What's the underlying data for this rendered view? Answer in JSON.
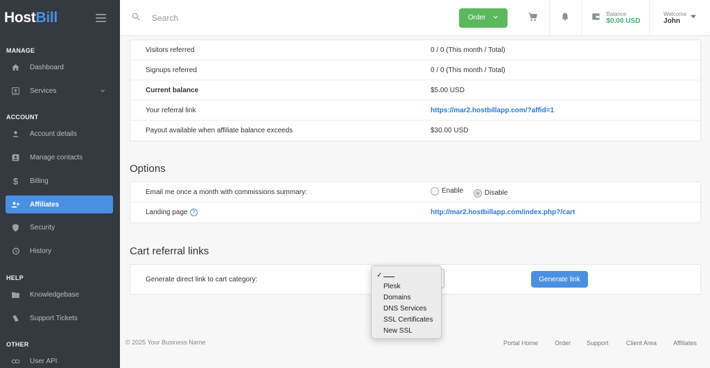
{
  "app": {
    "logo_host": "Host",
    "logo_bill": "Bill"
  },
  "sidebar": {
    "sections": {
      "manage": "MANAGE",
      "account": "ACCOUNT",
      "help": "HELP",
      "other": "OTHER"
    },
    "items": [
      {
        "label": "Dashboard",
        "icon": "home-icon"
      },
      {
        "label": "Services",
        "icon": "services-icon"
      },
      {
        "label": "Account details",
        "icon": "user-icon"
      },
      {
        "label": "Manage contacts",
        "icon": "contacts-icon"
      },
      {
        "label": "Billing",
        "icon": "dollar-icon"
      },
      {
        "label": "Affiliates",
        "icon": "add-user-icon"
      },
      {
        "label": "Security",
        "icon": "shield-icon"
      },
      {
        "label": "History",
        "icon": "history-icon"
      },
      {
        "label": "Knowledgebase",
        "icon": "folder-icon"
      },
      {
        "label": "Support Tickets",
        "icon": "tickets-icon"
      },
      {
        "label": "User API",
        "icon": "link-icon"
      }
    ]
  },
  "topbar": {
    "search_placeholder": "Search",
    "order_label": "Order",
    "balance_label": "Balance",
    "balance_value": "$0.00 USD",
    "welcome_label": "Welcome",
    "welcome_name": "John"
  },
  "stats": {
    "rows": [
      {
        "key": "Visitors referred",
        "value": "0 / 0 (This month / Total)"
      },
      {
        "key": "Signups referred",
        "value": "0 / 0 (This month / Total)"
      },
      {
        "key": "Current balance",
        "value": "$5.00 USD"
      },
      {
        "key": "Your referral link",
        "value": "https://mar2.hostbillapp.com/?affid=1"
      },
      {
        "key": "Payout available when affiliate balance exceeds",
        "value": "$30.00 USD"
      }
    ]
  },
  "options": {
    "title": "Options",
    "email_label": "Email me once a month with commissions summary:",
    "enable_label": "Enable",
    "disable_label": "Disable",
    "selected": "Disable",
    "landing_label": "Landing page",
    "landing_value": "http://mar2.hostbillapp.com/index.php?/cart"
  },
  "cart": {
    "title": "Cart referral links",
    "generate_label": "Generate direct link to cart category:",
    "generate_button": "Generate link",
    "options": [
      "Plesk",
      "Domains",
      "DNS Services",
      "SSL Certificates",
      "New SSL"
    ]
  },
  "footer": {
    "copyright": "© 2025 Your Business Name",
    "links": [
      "Portal Home",
      "Order",
      "Support",
      "Client Area",
      "Affiliates"
    ]
  },
  "colors": {
    "accent": "#4a90e2",
    "order_green": "#5cb85c",
    "balance_green": "#3cb371",
    "sidebar_bg": "#353940"
  }
}
